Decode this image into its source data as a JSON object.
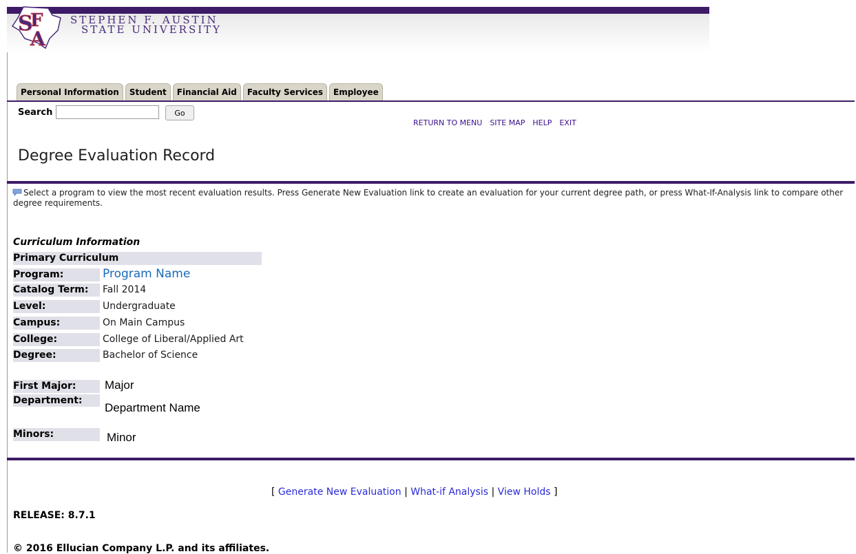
{
  "header": {
    "university_line1": "STEPHEN F. AUSTIN",
    "university_line2": "STATE UNIVERSITY",
    "logo_monogram": "SFA"
  },
  "tabs": [
    {
      "label": "Personal Information"
    },
    {
      "label": "Student"
    },
    {
      "label": "Financial Aid"
    },
    {
      "label": "Faculty Services"
    },
    {
      "label": "Employee"
    }
  ],
  "search": {
    "label": "Search",
    "value": "",
    "placeholder": "",
    "go_label": "Go"
  },
  "topnav": {
    "return": "RETURN TO MENU",
    "sitemap": "SITE MAP",
    "help": "HELP",
    "exit": "EXIT"
  },
  "page": {
    "title": "Degree Evaluation Record",
    "info": "Select a program to view the most recent evaluation results. Press Generate New Evaluation link to create an evaluation for your current degree path, or press What-If-Analysis link to compare other degree requirements."
  },
  "curriculum": {
    "section_title": "Curriculum Information",
    "primary_header": "Primary Curriculum",
    "rows": [
      {
        "label": "Program:",
        "value": "Program Name"
      },
      {
        "label": "Catalog Term:",
        "value": "Fall 2014"
      },
      {
        "label": "Level:",
        "value": "Undergraduate"
      },
      {
        "label": "Campus:",
        "value": "On Main Campus"
      },
      {
        "label": "College:",
        "value": "College of Liberal/Applied Art"
      },
      {
        "label": "Degree:",
        "value": "Bachelor of Science"
      }
    ],
    "first_major": {
      "label": "First Major:",
      "value": "Major"
    },
    "department": {
      "label": "Department:",
      "value": "Department Name"
    },
    "minors": {
      "label": "Minors:",
      "value": "Minor"
    }
  },
  "footer": {
    "open": "[",
    "generate": "Generate New Evaluation",
    "sep": "|",
    "whatif": "What-if Analysis",
    "holds": "View Holds",
    "close": "]",
    "release": "RELEASE: 8.7.1",
    "copyright": "© 2016 Ellucian Company L.P. and its affiliates."
  },
  "colors": {
    "brand_purple": "#3d1b66",
    "link_blue": "#1a6bb8",
    "nav_purple": "#3b0f8c"
  }
}
